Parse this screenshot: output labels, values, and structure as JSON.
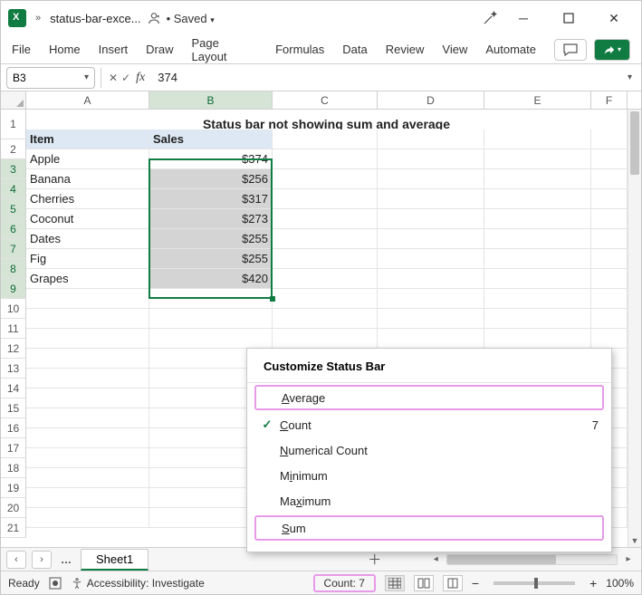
{
  "titlebar": {
    "file_name": "status-bar-exce...",
    "saved_label": "Saved",
    "saved_prefix": "•"
  },
  "ribbon": {
    "tabs": [
      "File",
      "Home",
      "Insert",
      "Draw",
      "Page Layout",
      "Formulas",
      "Data",
      "Review",
      "View",
      "Automate"
    ]
  },
  "formula_bar": {
    "namebox": "B3",
    "formula": "374"
  },
  "columns": [
    "A",
    "B",
    "C",
    "D",
    "E",
    "F"
  ],
  "title_row": "Status bar not showing sum and average",
  "headers": {
    "item": "Item",
    "sales": "Sales"
  },
  "data_rows": [
    {
      "item": "Apple",
      "sales": "$374"
    },
    {
      "item": "Banana",
      "sales": "$256"
    },
    {
      "item": "Cherries",
      "sales": "$317"
    },
    {
      "item": "Coconut",
      "sales": "$273"
    },
    {
      "item": "Dates",
      "sales": "$255"
    },
    {
      "item": "Fig",
      "sales": "$255"
    },
    {
      "item": "Grapes",
      "sales": "$420"
    }
  ],
  "context_menu": {
    "title": "Customize Status Bar",
    "items": {
      "average": {
        "pre": "",
        "ul": "A",
        "post": "verage"
      },
      "count": {
        "pre": "",
        "ul": "C",
        "post": "ount",
        "value": "7"
      },
      "numcount": {
        "pre": "",
        "ul": "N",
        "post": "umerical Count"
      },
      "minimum": {
        "pre": "M",
        "ul": "i",
        "post": "nimum"
      },
      "maximum": {
        "pre": "Ma",
        "ul": "x",
        "post": "imum"
      },
      "sum": {
        "pre": "",
        "ul": "S",
        "post": "um"
      }
    }
  },
  "sheet_tab": "Sheet1",
  "statusbar": {
    "ready": "Ready",
    "accessibility": "Accessibility: Investigate",
    "count": "Count: 7",
    "zoom": "100%"
  }
}
